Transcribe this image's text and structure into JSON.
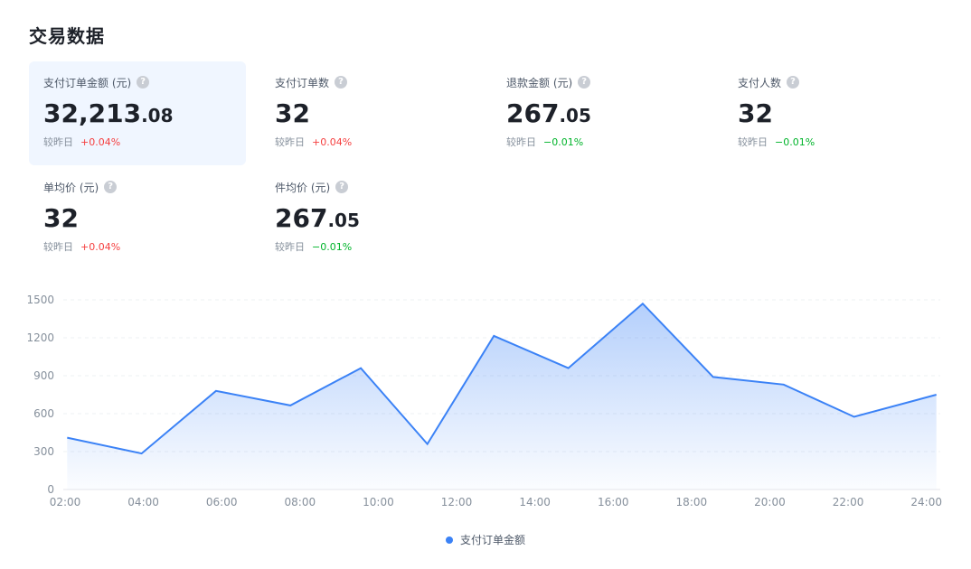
{
  "page": {
    "title": "交易数据"
  },
  "metrics": [
    {
      "label": "支付订单金额 (元)",
      "value_int": "32,213",
      "value_dec": ".08",
      "compare_label": "较昨日",
      "delta": "+0.04%",
      "trend": "up",
      "active": true
    },
    {
      "label": "支付订单数",
      "value_int": "32",
      "value_dec": "",
      "compare_label": "较昨日",
      "delta": "+0.04%",
      "trend": "up",
      "active": false
    },
    {
      "label": "退款金额 (元)",
      "value_int": "267",
      "value_dec": ".05",
      "compare_label": "较昨日",
      "delta": "−0.01%",
      "trend": "down",
      "active": false
    },
    {
      "label": "支付人数",
      "value_int": "32",
      "value_dec": "",
      "compare_label": "较昨日",
      "delta": "−0.01%",
      "trend": "down",
      "active": false
    },
    {
      "label": "单均价 (元)",
      "value_int": "32",
      "value_dec": "",
      "compare_label": "较昨日",
      "delta": "+0.04%",
      "trend": "up",
      "active": false
    },
    {
      "label": "件均价 (元)",
      "value_int": "267",
      "value_dec": ".05",
      "compare_label": "较昨日",
      "delta": "−0.01%",
      "trend": "down",
      "active": false
    }
  ],
  "icons": {
    "help": "question-circle-icon",
    "help_glyph": "?"
  },
  "colors": {
    "accent": "#3b82f6",
    "up": "#f53f3f",
    "down": "#00b42a",
    "active_card_bg": "#f0f6ff"
  },
  "chart_data": {
    "type": "area",
    "x_ticks": [
      "02:00",
      "04:00",
      "06:00",
      "08:00",
      "10:00",
      "12:00",
      "14:00",
      "16:00",
      "18:00",
      "20:00",
      "22:00",
      "24:00"
    ],
    "y_ticks": [
      0,
      300,
      600,
      900,
      1200,
      1500
    ],
    "ylim": [
      0,
      1500
    ],
    "xlim": [
      2,
      24.4
    ],
    "grid": true,
    "legend_position": "bottom-center",
    "series": [
      {
        "name": "支付订单金额",
        "color": "#3b82f6",
        "x": [
          2.1,
          4.0,
          5.9,
          7.8,
          9.6,
          11.3,
          13.0,
          14.9,
          16.8,
          18.6,
          20.4,
          22.2,
          24.3
        ],
        "values": [
          410,
          285,
          780,
          665,
          960,
          360,
          1215,
          960,
          1470,
          890,
          830,
          575,
          750
        ]
      }
    ]
  }
}
